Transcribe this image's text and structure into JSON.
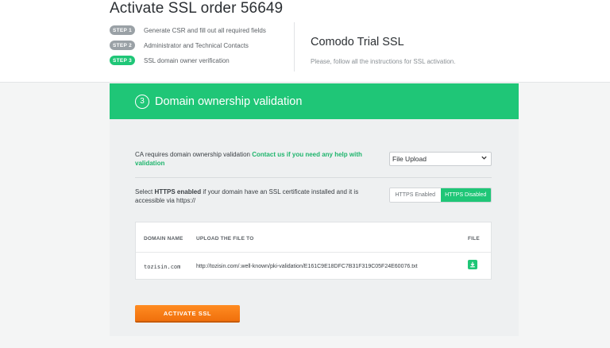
{
  "header": {
    "order_title": "Activate SSL order 56649",
    "steps": [
      {
        "badge": "STEP 1",
        "label": "Generate CSR and fill out all required fields",
        "active": false
      },
      {
        "badge": "STEP 2",
        "label": "Administrator and Technical Contacts",
        "active": false
      },
      {
        "badge": "STEP 3",
        "label": "SSL domain owner verification",
        "active": true
      }
    ],
    "product_name": "Comodo Trial SSL",
    "product_sub": "Please, follow all the instructions for SSL activation."
  },
  "card": {
    "step_number": "3",
    "title": "Domain ownership validation",
    "validation": {
      "text": "CA requires domain ownership validation ",
      "link": "Contact us if you need any help with validation",
      "method_selected": "File Upload"
    },
    "https": {
      "text_pre": "Select ",
      "text_bold": "HTTPS enabled",
      "text_post": " if your domain have an SSL certificate installed and it is accessible via https://",
      "option_enabled": "HTTPS Enabled",
      "option_disabled": "HTTPS Disabled",
      "selected": "HTTPS Disabled"
    },
    "table": {
      "col_domain": "DOMAIN NAME",
      "col_upload": "UPLOAD THE FILE TO",
      "col_file": "FILE",
      "row": {
        "domain": "tozisin.com",
        "url": "http://tozisin.com/.well-known/pki-validation/E161C9E18DFC7B31F319C05F24E60076.txt"
      }
    },
    "activate_label": "ACTIVATE SSL"
  },
  "colors": {
    "accent_green": "#1fc677",
    "activate_orange": "#f57d14",
    "step_inactive": "#9aa1a6"
  },
  "icons": {
    "select_chevron": "chevron-down-icon",
    "file_download": "download-icon"
  }
}
